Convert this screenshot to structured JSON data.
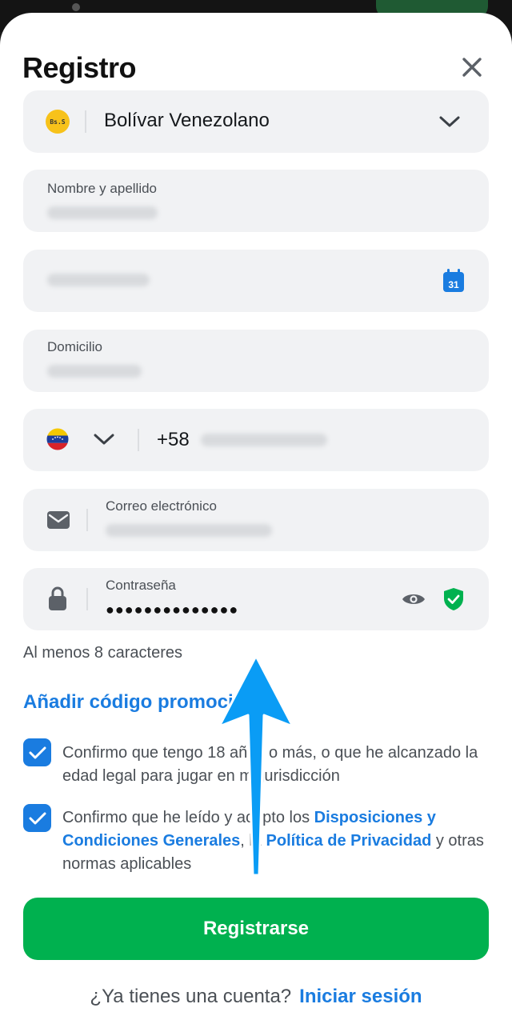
{
  "header": {
    "title": "Registro"
  },
  "currency": {
    "badge": "Bs.S",
    "value": "Bolívar Venezolano"
  },
  "name_field": {
    "label": "Nombre y apellido"
  },
  "birthdate_field": {
    "calendar_day": "31"
  },
  "address_field": {
    "label": "Domicilio"
  },
  "phone_field": {
    "country_code": "+58"
  },
  "email_field": {
    "label": "Correo electrónico"
  },
  "password_field": {
    "label": "Contraseña",
    "value": "●●●●●●●●●●●●●●",
    "hint": "Al menos 8 caracteres"
  },
  "promo": {
    "label": "Añadir código promocional"
  },
  "consent_age": {
    "text": "Confirmo que tengo 18 años o más, o que he alcanzado la edad legal para jugar en mi jurisdicción"
  },
  "consent_terms": {
    "prefix": "Confirmo que he leído y acepto los ",
    "link1": "Disposiciones y Condiciones Generales",
    "middle": ", la ",
    "link2": "Política de Privacidad",
    "suffix": " y otras normas aplicables"
  },
  "submit": {
    "label": "Registrarse"
  },
  "footer": {
    "question": "¿Ya tienes una cuenta?",
    "login_link": "Iniciar sesión"
  },
  "colors": {
    "accent": "#1a7ce0",
    "primary_button": "#00b14f",
    "field_bg": "#f1f2f4"
  }
}
